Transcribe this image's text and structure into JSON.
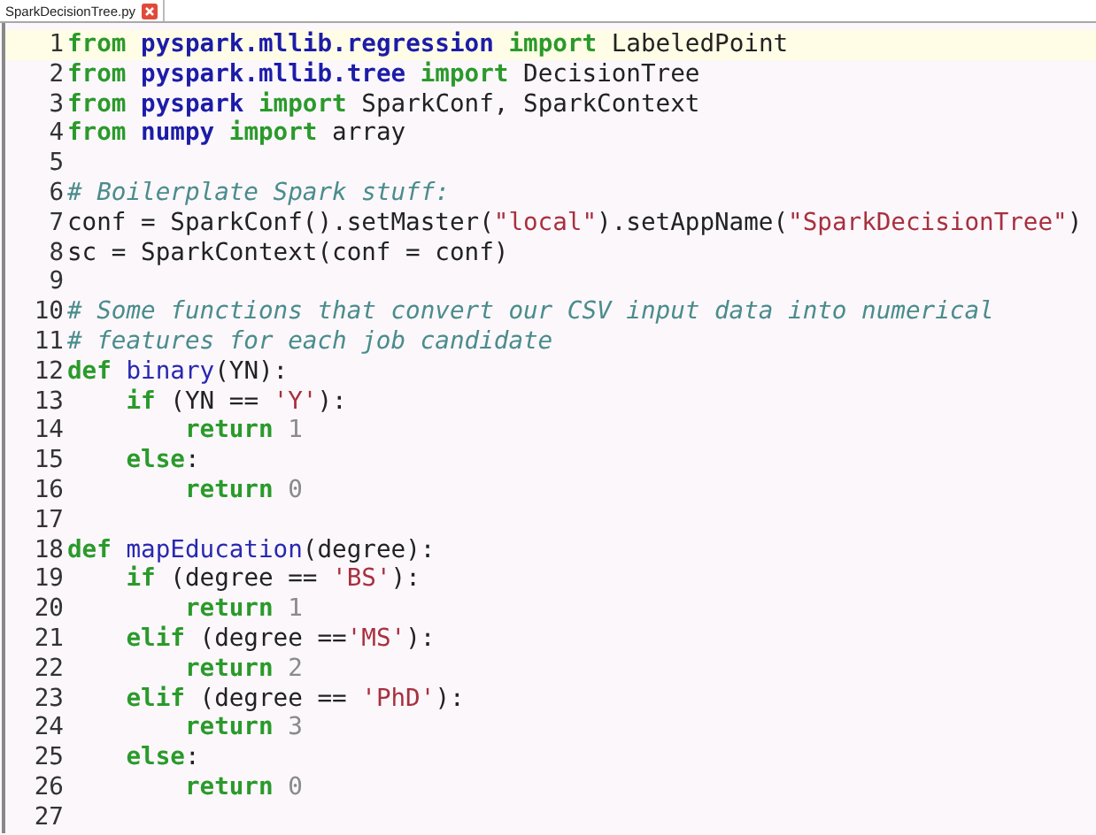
{
  "tabs": [
    {
      "title": "SparkDecisionTree.py",
      "selected": true,
      "closable": true
    }
  ],
  "editor": {
    "lines": [
      {
        "number": "1",
        "current": true,
        "tokens": [
          {
            "kind": "keyword",
            "text": "from "
          },
          {
            "kind": "module",
            "text": "pyspark.mllib.regression "
          },
          {
            "kind": "keyword",
            "text": "import "
          },
          {
            "kind": "plain",
            "text": "LabeledPoint"
          }
        ]
      },
      {
        "number": "2",
        "current": false,
        "tokens": [
          {
            "kind": "keyword",
            "text": "from "
          },
          {
            "kind": "module",
            "text": "pyspark.mllib.tree "
          },
          {
            "kind": "keyword",
            "text": "import "
          },
          {
            "kind": "plain",
            "text": "DecisionTree"
          }
        ]
      },
      {
        "number": "3",
        "current": false,
        "tokens": [
          {
            "kind": "keyword",
            "text": "from "
          },
          {
            "kind": "module",
            "text": "pyspark "
          },
          {
            "kind": "keyword",
            "text": "import "
          },
          {
            "kind": "plain",
            "text": "SparkConf, SparkContext"
          }
        ]
      },
      {
        "number": "4",
        "current": false,
        "tokens": [
          {
            "kind": "keyword",
            "text": "from "
          },
          {
            "kind": "module",
            "text": "numpy "
          },
          {
            "kind": "keyword",
            "text": "import "
          },
          {
            "kind": "plain",
            "text": "array"
          }
        ]
      },
      {
        "number": "5",
        "current": false
      },
      {
        "number": "6",
        "current": false,
        "tokens": [
          {
            "kind": "comment",
            "text": "# Boilerplate Spark stuff:"
          }
        ]
      },
      {
        "number": "7",
        "current": false,
        "tokens": [
          {
            "kind": "plain",
            "text": "conf = SparkConf().setMaster("
          },
          {
            "kind": "string",
            "text": "\"local\""
          },
          {
            "kind": "plain",
            "text": ").setAppName("
          },
          {
            "kind": "string",
            "text": "\"SparkDecisionTree\""
          },
          {
            "kind": "plain",
            "text": ")"
          }
        ]
      },
      {
        "number": "8",
        "current": false,
        "tokens": [
          {
            "kind": "plain",
            "text": "sc = SparkContext(conf = conf)"
          }
        ]
      },
      {
        "number": "9",
        "current": false
      },
      {
        "number": "10",
        "current": false,
        "tokens": [
          {
            "kind": "comment",
            "text": "# Some functions that convert our CSV input data into numerical"
          }
        ]
      },
      {
        "number": "11",
        "current": false,
        "tokens": [
          {
            "kind": "comment",
            "text": "# features for each job candidate"
          }
        ]
      },
      {
        "number": "12",
        "current": false,
        "tokens": [
          {
            "kind": "keyword",
            "text": "def "
          },
          {
            "kind": "function",
            "text": "binary"
          },
          {
            "kind": "plain",
            "text": "(YN):"
          }
        ]
      },
      {
        "number": "13",
        "current": false,
        "tokens": [
          {
            "kind": "keyword",
            "text": "    if "
          },
          {
            "kind": "plain",
            "text": "(YN == "
          },
          {
            "kind": "string",
            "text": "'Y'"
          },
          {
            "kind": "plain",
            "text": "):"
          }
        ]
      },
      {
        "number": "14",
        "current": false,
        "tokens": [
          {
            "kind": "keyword",
            "text": "        return "
          },
          {
            "kind": "number",
            "text": "1"
          }
        ]
      },
      {
        "number": "15",
        "current": false,
        "tokens": [
          {
            "kind": "keyword",
            "text": "    else"
          },
          {
            "kind": "plain",
            "text": ":"
          }
        ]
      },
      {
        "number": "16",
        "current": false,
        "tokens": [
          {
            "kind": "keyword",
            "text": "        return "
          },
          {
            "kind": "number",
            "text": "0"
          }
        ]
      },
      {
        "number": "17",
        "current": false
      },
      {
        "number": "18",
        "current": false,
        "tokens": [
          {
            "kind": "keyword",
            "text": "def "
          },
          {
            "kind": "function",
            "text": "mapEducation"
          },
          {
            "kind": "plain",
            "text": "(degree):"
          }
        ]
      },
      {
        "number": "19",
        "current": false,
        "tokens": [
          {
            "kind": "keyword",
            "text": "    if "
          },
          {
            "kind": "plain",
            "text": "(degree == "
          },
          {
            "kind": "string",
            "text": "'BS'"
          },
          {
            "kind": "plain",
            "text": "):"
          }
        ]
      },
      {
        "number": "20",
        "current": false,
        "tokens": [
          {
            "kind": "keyword",
            "text": "        return "
          },
          {
            "kind": "number",
            "text": "1"
          }
        ]
      },
      {
        "number": "21",
        "current": false,
        "tokens": [
          {
            "kind": "keyword",
            "text": "    elif "
          },
          {
            "kind": "plain",
            "text": "(degree =="
          },
          {
            "kind": "string",
            "text": "'MS'"
          },
          {
            "kind": "plain",
            "text": "):"
          }
        ]
      },
      {
        "number": "22",
        "current": false,
        "tokens": [
          {
            "kind": "keyword",
            "text": "        return "
          },
          {
            "kind": "number",
            "text": "2"
          }
        ]
      },
      {
        "number": "23",
        "current": false,
        "tokens": [
          {
            "kind": "keyword",
            "text": "    elif "
          },
          {
            "kind": "plain",
            "text": "(degree == "
          },
          {
            "kind": "string",
            "text": "'PhD'"
          },
          {
            "kind": "plain",
            "text": "):"
          }
        ]
      },
      {
        "number": "24",
        "current": false,
        "tokens": [
          {
            "kind": "keyword",
            "text": "        return "
          },
          {
            "kind": "number",
            "text": "3"
          }
        ]
      },
      {
        "number": "25",
        "current": false,
        "tokens": [
          {
            "kind": "keyword",
            "text": "    else"
          },
          {
            "kind": "plain",
            "text": ":"
          }
        ]
      },
      {
        "number": "26",
        "current": false,
        "tokens": [
          {
            "kind": "keyword",
            "text": "        return "
          },
          {
            "kind": "number",
            "text": "0"
          }
        ]
      },
      {
        "number": "27",
        "current": false
      }
    ]
  }
}
